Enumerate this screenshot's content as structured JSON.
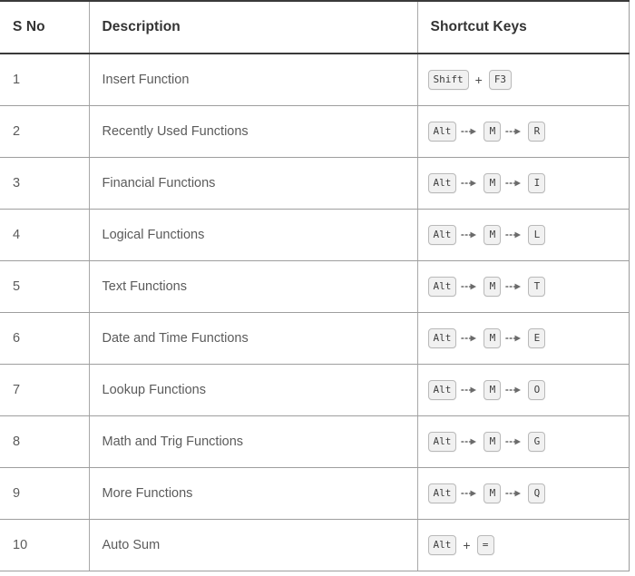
{
  "table": {
    "columns": [
      {
        "key": "sno",
        "label": "S No"
      },
      {
        "key": "desc",
        "label": "Description"
      },
      {
        "key": "keys",
        "label": "Shortcut Keys"
      }
    ],
    "rows": [
      {
        "sno": "1",
        "desc": "Insert Function",
        "keys": [
          {
            "type": "key",
            "label": "Shift"
          },
          {
            "type": "plus",
            "label": "+"
          },
          {
            "type": "key",
            "label": "F3"
          }
        ]
      },
      {
        "sno": "2",
        "desc": "Recently Used Functions",
        "keys": [
          {
            "type": "key",
            "label": "Alt"
          },
          {
            "type": "arrow",
            "label": "⇢"
          },
          {
            "type": "key",
            "label": "M"
          },
          {
            "type": "arrow",
            "label": "⇢"
          },
          {
            "type": "key",
            "label": "R"
          }
        ]
      },
      {
        "sno": "3",
        "desc": "Financial Functions",
        "keys": [
          {
            "type": "key",
            "label": "Alt"
          },
          {
            "type": "arrow",
            "label": "⇢"
          },
          {
            "type": "key",
            "label": "M"
          },
          {
            "type": "arrow",
            "label": "⇢"
          },
          {
            "type": "key",
            "label": "I"
          }
        ]
      },
      {
        "sno": "4",
        "desc": "Logical Functions",
        "keys": [
          {
            "type": "key",
            "label": "Alt"
          },
          {
            "type": "arrow",
            "label": "⇢"
          },
          {
            "type": "key",
            "label": "M"
          },
          {
            "type": "arrow",
            "label": "⇢"
          },
          {
            "type": "key",
            "label": "L"
          }
        ]
      },
      {
        "sno": "5",
        "desc": "Text Functions",
        "keys": [
          {
            "type": "key",
            "label": "Alt"
          },
          {
            "type": "arrow",
            "label": "⇢"
          },
          {
            "type": "key",
            "label": "M"
          },
          {
            "type": "arrow",
            "label": "⇢"
          },
          {
            "type": "key",
            "label": "T"
          }
        ]
      },
      {
        "sno": "6",
        "desc": "Date and Time Functions",
        "keys": [
          {
            "type": "key",
            "label": "Alt"
          },
          {
            "type": "arrow",
            "label": "⇢"
          },
          {
            "type": "key",
            "label": "M"
          },
          {
            "type": "arrow",
            "label": "⇢"
          },
          {
            "type": "key",
            "label": "E"
          }
        ]
      },
      {
        "sno": "7",
        "desc": "Lookup Functions",
        "keys": [
          {
            "type": "key",
            "label": "Alt"
          },
          {
            "type": "arrow",
            "label": "⇢"
          },
          {
            "type": "key",
            "label": "M"
          },
          {
            "type": "arrow",
            "label": "⇢"
          },
          {
            "type": "key",
            "label": "O"
          }
        ]
      },
      {
        "sno": "8",
        "desc": "Math and Trig Functions",
        "keys": [
          {
            "type": "key",
            "label": "Alt"
          },
          {
            "type": "arrow",
            "label": "⇢"
          },
          {
            "type": "key",
            "label": "M"
          },
          {
            "type": "arrow",
            "label": "⇢"
          },
          {
            "type": "key",
            "label": "G"
          }
        ]
      },
      {
        "sno": "9",
        "desc": "More Functions",
        "keys": [
          {
            "type": "key",
            "label": "Alt"
          },
          {
            "type": "arrow",
            "label": "⇢"
          },
          {
            "type": "key",
            "label": "M"
          },
          {
            "type": "arrow",
            "label": "⇢"
          },
          {
            "type": "key",
            "label": "Q"
          }
        ]
      },
      {
        "sno": "10",
        "desc": "Auto Sum",
        "keys": [
          {
            "type": "key",
            "label": "Alt"
          },
          {
            "type": "plus",
            "label": "+"
          },
          {
            "type": "key",
            "label": "="
          }
        ]
      }
    ]
  },
  "colors": {
    "header_text": "#333333",
    "body_text": "#5b5b5b",
    "header_rule": "#3a3a3a",
    "grid_line": "#9e9e9e",
    "key_bg": "#f1f1f1",
    "key_border": "#b9b9b9",
    "key_text": "#3d3d3d"
  }
}
